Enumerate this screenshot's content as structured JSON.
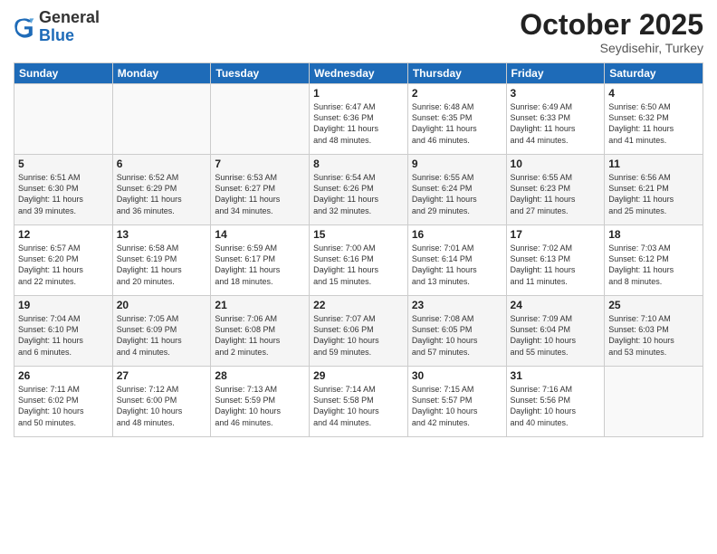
{
  "header": {
    "logo_general": "General",
    "logo_blue": "Blue",
    "month": "October 2025",
    "location": "Seydisehir, Turkey"
  },
  "weekdays": [
    "Sunday",
    "Monday",
    "Tuesday",
    "Wednesday",
    "Thursday",
    "Friday",
    "Saturday"
  ],
  "weeks": [
    [
      {
        "day": "",
        "info": ""
      },
      {
        "day": "",
        "info": ""
      },
      {
        "day": "",
        "info": ""
      },
      {
        "day": "1",
        "info": "Sunrise: 6:47 AM\nSunset: 6:36 PM\nDaylight: 11 hours\nand 48 minutes."
      },
      {
        "day": "2",
        "info": "Sunrise: 6:48 AM\nSunset: 6:35 PM\nDaylight: 11 hours\nand 46 minutes."
      },
      {
        "day": "3",
        "info": "Sunrise: 6:49 AM\nSunset: 6:33 PM\nDaylight: 11 hours\nand 44 minutes."
      },
      {
        "day": "4",
        "info": "Sunrise: 6:50 AM\nSunset: 6:32 PM\nDaylight: 11 hours\nand 41 minutes."
      }
    ],
    [
      {
        "day": "5",
        "info": "Sunrise: 6:51 AM\nSunset: 6:30 PM\nDaylight: 11 hours\nand 39 minutes."
      },
      {
        "day": "6",
        "info": "Sunrise: 6:52 AM\nSunset: 6:29 PM\nDaylight: 11 hours\nand 36 minutes."
      },
      {
        "day": "7",
        "info": "Sunrise: 6:53 AM\nSunset: 6:27 PM\nDaylight: 11 hours\nand 34 minutes."
      },
      {
        "day": "8",
        "info": "Sunrise: 6:54 AM\nSunset: 6:26 PM\nDaylight: 11 hours\nand 32 minutes."
      },
      {
        "day": "9",
        "info": "Sunrise: 6:55 AM\nSunset: 6:24 PM\nDaylight: 11 hours\nand 29 minutes."
      },
      {
        "day": "10",
        "info": "Sunrise: 6:55 AM\nSunset: 6:23 PM\nDaylight: 11 hours\nand 27 minutes."
      },
      {
        "day": "11",
        "info": "Sunrise: 6:56 AM\nSunset: 6:21 PM\nDaylight: 11 hours\nand 25 minutes."
      }
    ],
    [
      {
        "day": "12",
        "info": "Sunrise: 6:57 AM\nSunset: 6:20 PM\nDaylight: 11 hours\nand 22 minutes."
      },
      {
        "day": "13",
        "info": "Sunrise: 6:58 AM\nSunset: 6:19 PM\nDaylight: 11 hours\nand 20 minutes."
      },
      {
        "day": "14",
        "info": "Sunrise: 6:59 AM\nSunset: 6:17 PM\nDaylight: 11 hours\nand 18 minutes."
      },
      {
        "day": "15",
        "info": "Sunrise: 7:00 AM\nSunset: 6:16 PM\nDaylight: 11 hours\nand 15 minutes."
      },
      {
        "day": "16",
        "info": "Sunrise: 7:01 AM\nSunset: 6:14 PM\nDaylight: 11 hours\nand 13 minutes."
      },
      {
        "day": "17",
        "info": "Sunrise: 7:02 AM\nSunset: 6:13 PM\nDaylight: 11 hours\nand 11 minutes."
      },
      {
        "day": "18",
        "info": "Sunrise: 7:03 AM\nSunset: 6:12 PM\nDaylight: 11 hours\nand 8 minutes."
      }
    ],
    [
      {
        "day": "19",
        "info": "Sunrise: 7:04 AM\nSunset: 6:10 PM\nDaylight: 11 hours\nand 6 minutes."
      },
      {
        "day": "20",
        "info": "Sunrise: 7:05 AM\nSunset: 6:09 PM\nDaylight: 11 hours\nand 4 minutes."
      },
      {
        "day": "21",
        "info": "Sunrise: 7:06 AM\nSunset: 6:08 PM\nDaylight: 11 hours\nand 2 minutes."
      },
      {
        "day": "22",
        "info": "Sunrise: 7:07 AM\nSunset: 6:06 PM\nDaylight: 10 hours\nand 59 minutes."
      },
      {
        "day": "23",
        "info": "Sunrise: 7:08 AM\nSunset: 6:05 PM\nDaylight: 10 hours\nand 57 minutes."
      },
      {
        "day": "24",
        "info": "Sunrise: 7:09 AM\nSunset: 6:04 PM\nDaylight: 10 hours\nand 55 minutes."
      },
      {
        "day": "25",
        "info": "Sunrise: 7:10 AM\nSunset: 6:03 PM\nDaylight: 10 hours\nand 53 minutes."
      }
    ],
    [
      {
        "day": "26",
        "info": "Sunrise: 7:11 AM\nSunset: 6:02 PM\nDaylight: 10 hours\nand 50 minutes."
      },
      {
        "day": "27",
        "info": "Sunrise: 7:12 AM\nSunset: 6:00 PM\nDaylight: 10 hours\nand 48 minutes."
      },
      {
        "day": "28",
        "info": "Sunrise: 7:13 AM\nSunset: 5:59 PM\nDaylight: 10 hours\nand 46 minutes."
      },
      {
        "day": "29",
        "info": "Sunrise: 7:14 AM\nSunset: 5:58 PM\nDaylight: 10 hours\nand 44 minutes."
      },
      {
        "day": "30",
        "info": "Sunrise: 7:15 AM\nSunset: 5:57 PM\nDaylight: 10 hours\nand 42 minutes."
      },
      {
        "day": "31",
        "info": "Sunrise: 7:16 AM\nSunset: 5:56 PM\nDaylight: 10 hours\nand 40 minutes."
      },
      {
        "day": "",
        "info": ""
      }
    ]
  ]
}
